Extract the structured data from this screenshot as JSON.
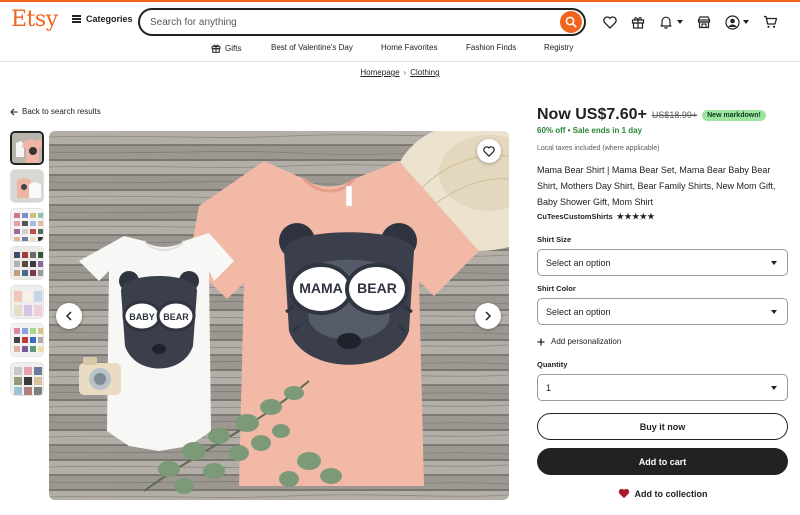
{
  "brand": {
    "logo_text": "Etsy",
    "accent_color": "#f1641e"
  },
  "header": {
    "categories_label": "Categories",
    "search_placeholder": "Search for anything",
    "icons": [
      "heart-icon",
      "gift-icon",
      "bell-icon",
      "shop-icon",
      "account-icon",
      "cart-icon"
    ]
  },
  "nav": {
    "items": [
      "Gifts",
      "Best of Valentine's Day",
      "Home Favorites",
      "Fashion Finds",
      "Registry"
    ]
  },
  "breadcrumb": {
    "items": [
      "Homepage",
      "Clothing"
    ]
  },
  "back_link": "Back to search results",
  "gallery": {
    "thumbnail_count": 7,
    "active_index": 0
  },
  "listing": {
    "price_now": "Now US$7.60+",
    "price_original": "US$18.99+",
    "markdown_badge": "New markdown!",
    "discount": "60% off",
    "sale_note": "Sale ends in 1 day",
    "tax_note": "Local taxes included (where applicable)",
    "title": "Mama Bear Shirt | Mama Bear Set, Mama Bear Baby Bear Shirt, Mothers Day Shirt, Bear Family Shirts, New Mom Gift, Baby Shower Gift, Mom Shirt",
    "shop_name": "CuTeesCustomShirts",
    "rating_stars": "★★★★★",
    "rating_value": 5
  },
  "options": {
    "shirt_size": {
      "label": "Shirt Size",
      "value": "Select an option"
    },
    "shirt_color": {
      "label": "Shirt Color",
      "value": "Select an option"
    },
    "personalization": "Add personalization",
    "quantity": {
      "label": "Quantity",
      "value": "1"
    }
  },
  "actions": {
    "buy_now": "Buy it now",
    "add_to_cart": "Add to cart",
    "add_to_collection": "Add to collection"
  },
  "image_text": {
    "baby_shirt_left": "BABY",
    "baby_shirt_right": "BEAR",
    "mama_shirt_left": "MAMA",
    "mama_shirt_right": "BEAR"
  }
}
